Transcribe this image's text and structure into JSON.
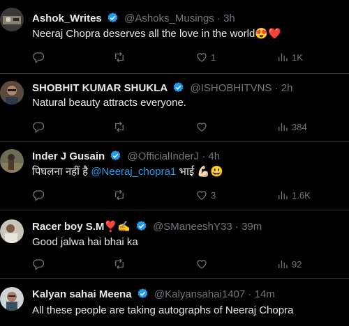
{
  "tweets": [
    {
      "name": "Ashok_Writes",
      "handle": "@Ashoks_Musings",
      "time": "3h",
      "text": "Neeraj Chopra deserves all the love in the world",
      "emoji": "😍❤️",
      "replies": "",
      "retweets": "",
      "likes": "1",
      "views": "1K"
    },
    {
      "name": "SHOBHIT KUMAR SHUKLA",
      "handle": "@ISHOBHITVNS",
      "time": "2h",
      "text": "Natural beauty attracts everyone.",
      "replies": "",
      "retweets": "",
      "likes": "",
      "views": "384"
    },
    {
      "name": "Inder J Gusain",
      "handle": "@OfficialInderJ",
      "time": "4h",
      "text_pre": "पिघलना नहीं है ",
      "mention": "@Neeraj_chopra1",
      "text_post": " भाई 💪🏻😃",
      "replies": "",
      "retweets": "",
      "likes": "3",
      "views": "1.6K"
    },
    {
      "name": "Racer boy S.M",
      "name_emoji": "❣️✍️",
      "handle": "@SManeeshY33",
      "time": "39m",
      "text": "Good jalwa hai bhai ka",
      "replies": "",
      "retweets": "",
      "likes": "",
      "views": "92"
    },
    {
      "name": "Kalyan sahai Meena",
      "handle": "@Kalyansahai1407",
      "time": "14m",
      "text": "All these people are taking autographs of Neeraj Chopra"
    }
  ],
  "separator": "·",
  "colors": {
    "background": "#000000",
    "text": "#e7e9ea",
    "muted": "#71767b",
    "link": "#1d9bf0",
    "verified": "#1d9bf0",
    "like": "#f91880"
  }
}
